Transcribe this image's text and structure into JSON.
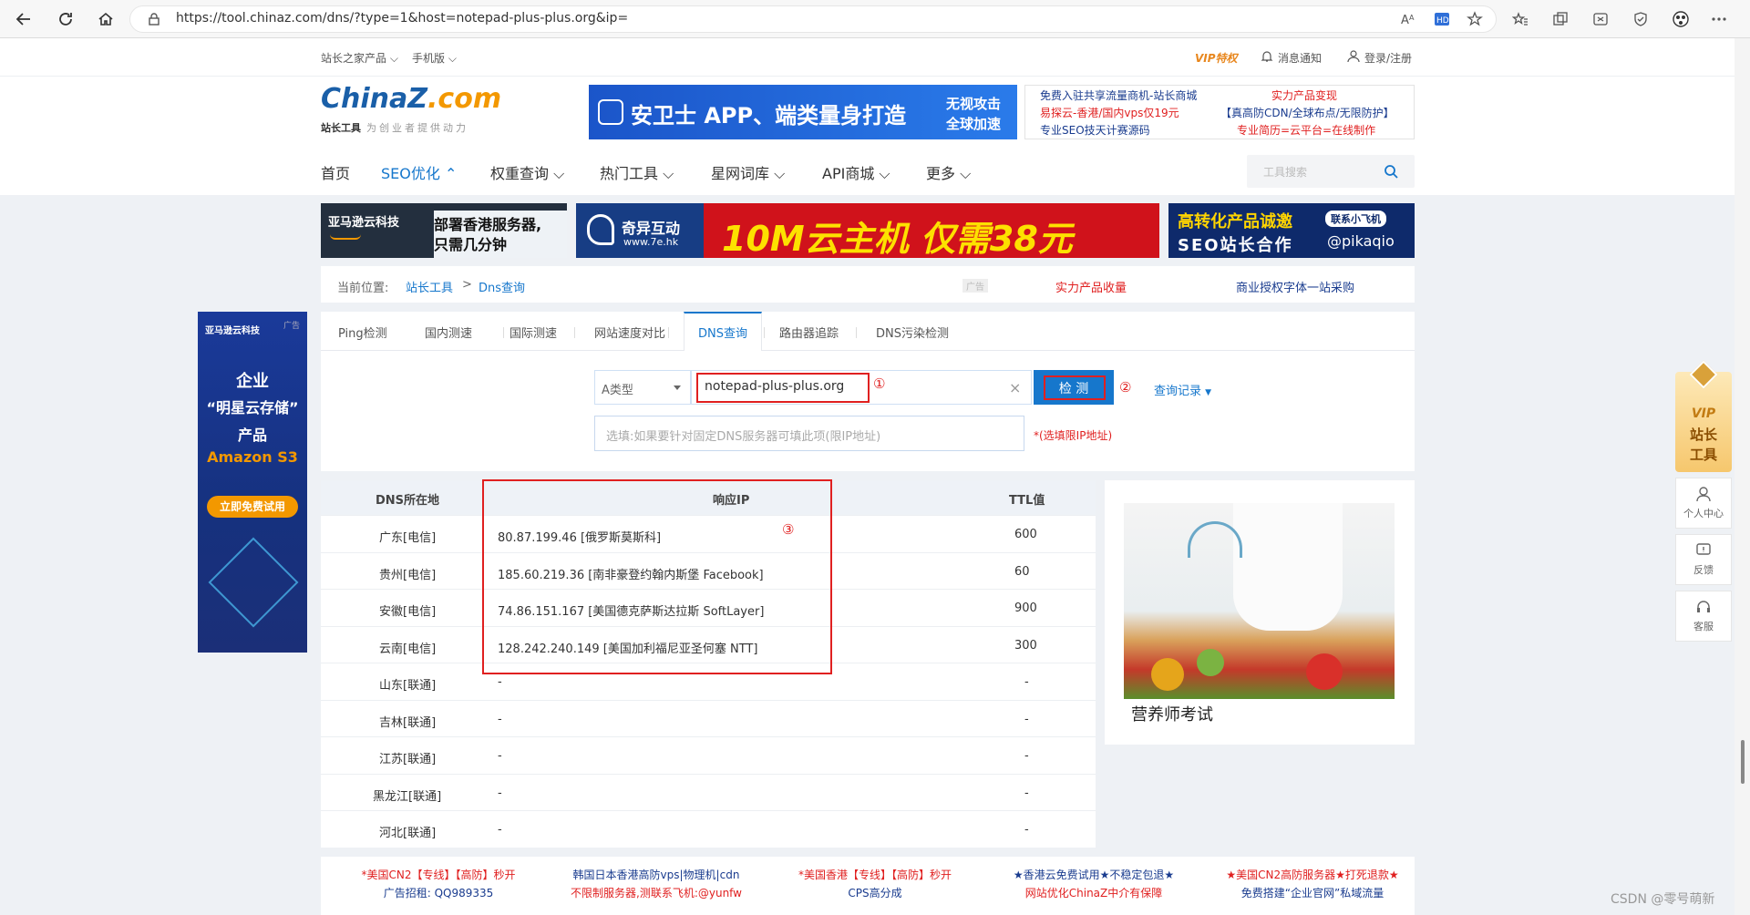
{
  "browser": {
    "url": "https://tool.chinaz.com/dns/?type=1&host=notepad-plus-plus.org&ip="
  },
  "topbar": {
    "products": "站长之家产品",
    "mobile": "手机版",
    "vip": "VIP特权",
    "notifications": "消息通知",
    "login": "登录/注册"
  },
  "logo": {
    "name_china": "China",
    "name_z": "Z",
    "name_com": ".com",
    "sub_bold": "站长工具",
    "sub_light": "为创业者提供动力"
  },
  "ads": {
    "banner_main": "安卫士 APP、端类量身打造",
    "banner_main_right1": "无视攻击",
    "banner_main_right2": "全球加速",
    "ad_label": "广告",
    "text_ads": [
      "免费入驻共享流量商机-站长商城",
      "实力产品变现",
      "易探云-香港/国内vps仅19元",
      "【真高防CDN/全球布点/无限防护】",
      "专业SEO技天计赛源码",
      "专业简历=云平台=在线制作"
    ],
    "amazon_brand": "亚马逊云科技",
    "amazon_text1": "部署香港服务器,",
    "amazon_text2": "只需几分钟",
    "qiyi_brand": "奇异互动",
    "qiyi_site": "www.7e.hk",
    "qiyi_slogan": "10M云主机 仅需38元",
    "pika_text1": "高转化产品诚邀",
    "pika_text2": "SEO站长合作",
    "pika_contact": "联系小飞机",
    "pika_handle": "@pikaqio",
    "left_brand": "亚马逊云科技",
    "left_l1": "企业",
    "left_l2": "“明星云存储”",
    "left_l3": "产品",
    "left_l4": "Amazon S3",
    "left_cta": "立即免费试用",
    "right_caption": "营养师考试"
  },
  "nav": {
    "items": [
      "首页",
      "SEO优化",
      "权重查询",
      "热门工具",
      "星网词库",
      "API商城",
      "更多"
    ],
    "search_placeholder": "工具搜索"
  },
  "breadcrumb": {
    "prefix": "当前位置:",
    "root": "站长工具",
    "sep": ">",
    "current": "Dns查询",
    "link1": "实力产品收量",
    "link2": "商业授权字体一站采购"
  },
  "tabs": [
    "Ping检测",
    "国内测速",
    "国际测速",
    "网站速度对比",
    "DNS查询",
    "路由器追踪",
    "DNS污染检测"
  ],
  "query": {
    "type_value": "A类型",
    "host_value": "notepad-plus-plus.org",
    "check_label": "检 测",
    "history_label": "查询记录",
    "ip_placeholder": "选填:如果要针对固定DNS服务器可填此项(限IP地址)",
    "ip_hint": "*(选填限IP地址)",
    "marker1": "①",
    "marker2": "②",
    "marker3": "③"
  },
  "table": {
    "headers": [
      "DNS所在地",
      "响应IP",
      "TTL值"
    ],
    "rows": [
      {
        "loc": "广东[电信]",
        "ip": "80.87.199.46 [俄罗斯莫斯科]",
        "ttl": "600"
      },
      {
        "loc": "贵州[电信]",
        "ip": "185.60.219.36 [南非豪登约翰内斯堡 Facebook]",
        "ttl": "60"
      },
      {
        "loc": "安徽[电信]",
        "ip": "74.86.151.167 [美国德克萨斯达拉斯 SoftLayer]",
        "ttl": "900"
      },
      {
        "loc": "云南[电信]",
        "ip": "128.242.240.149 [美国加利福尼亚圣何塞 NTT]",
        "ttl": "300"
      },
      {
        "loc": "山东[联通]",
        "ip": "-",
        "ttl": "-"
      },
      {
        "loc": "吉林[联通]",
        "ip": "-",
        "ttl": "-"
      },
      {
        "loc": "江苏[联通]",
        "ip": "-",
        "ttl": "-"
      },
      {
        "loc": "黑龙江[联通]",
        "ip": "-",
        "ttl": "-"
      },
      {
        "loc": "河北[联通]",
        "ip": "-",
        "ttl": "-"
      }
    ]
  },
  "side": {
    "vip1": "VIP",
    "vip2": "站长",
    "vip3": "工具",
    "user": "个人中心",
    "feedback": "反馈",
    "service": "客服"
  },
  "footer_ads": [
    [
      "*美国CN2【专线】【高防】秒开",
      "广告招租: QQ989335"
    ],
    [
      "韩国日本香港高防vps|物理机|cdn",
      "不限制服务器,测联系飞机:@yunfw"
    ],
    [
      "*美国香港【专线】【高防】秒开",
      "CPS高分成"
    ],
    [
      "★香港云免费试用★不稳定包退★",
      "网站优化ChinaZ中介有保障"
    ],
    [
      "★美国CN2高防服务器★打死退款★",
      "免费搭建“企业官网”私域流量"
    ]
  ],
  "watermark": "CSDN @零号萌新",
  "colors": {
    "accent": "#1677cc",
    "red_highlight": "#e02020",
    "brand_blue": "#1a5fa8",
    "brand_orange": "#f39800"
  }
}
